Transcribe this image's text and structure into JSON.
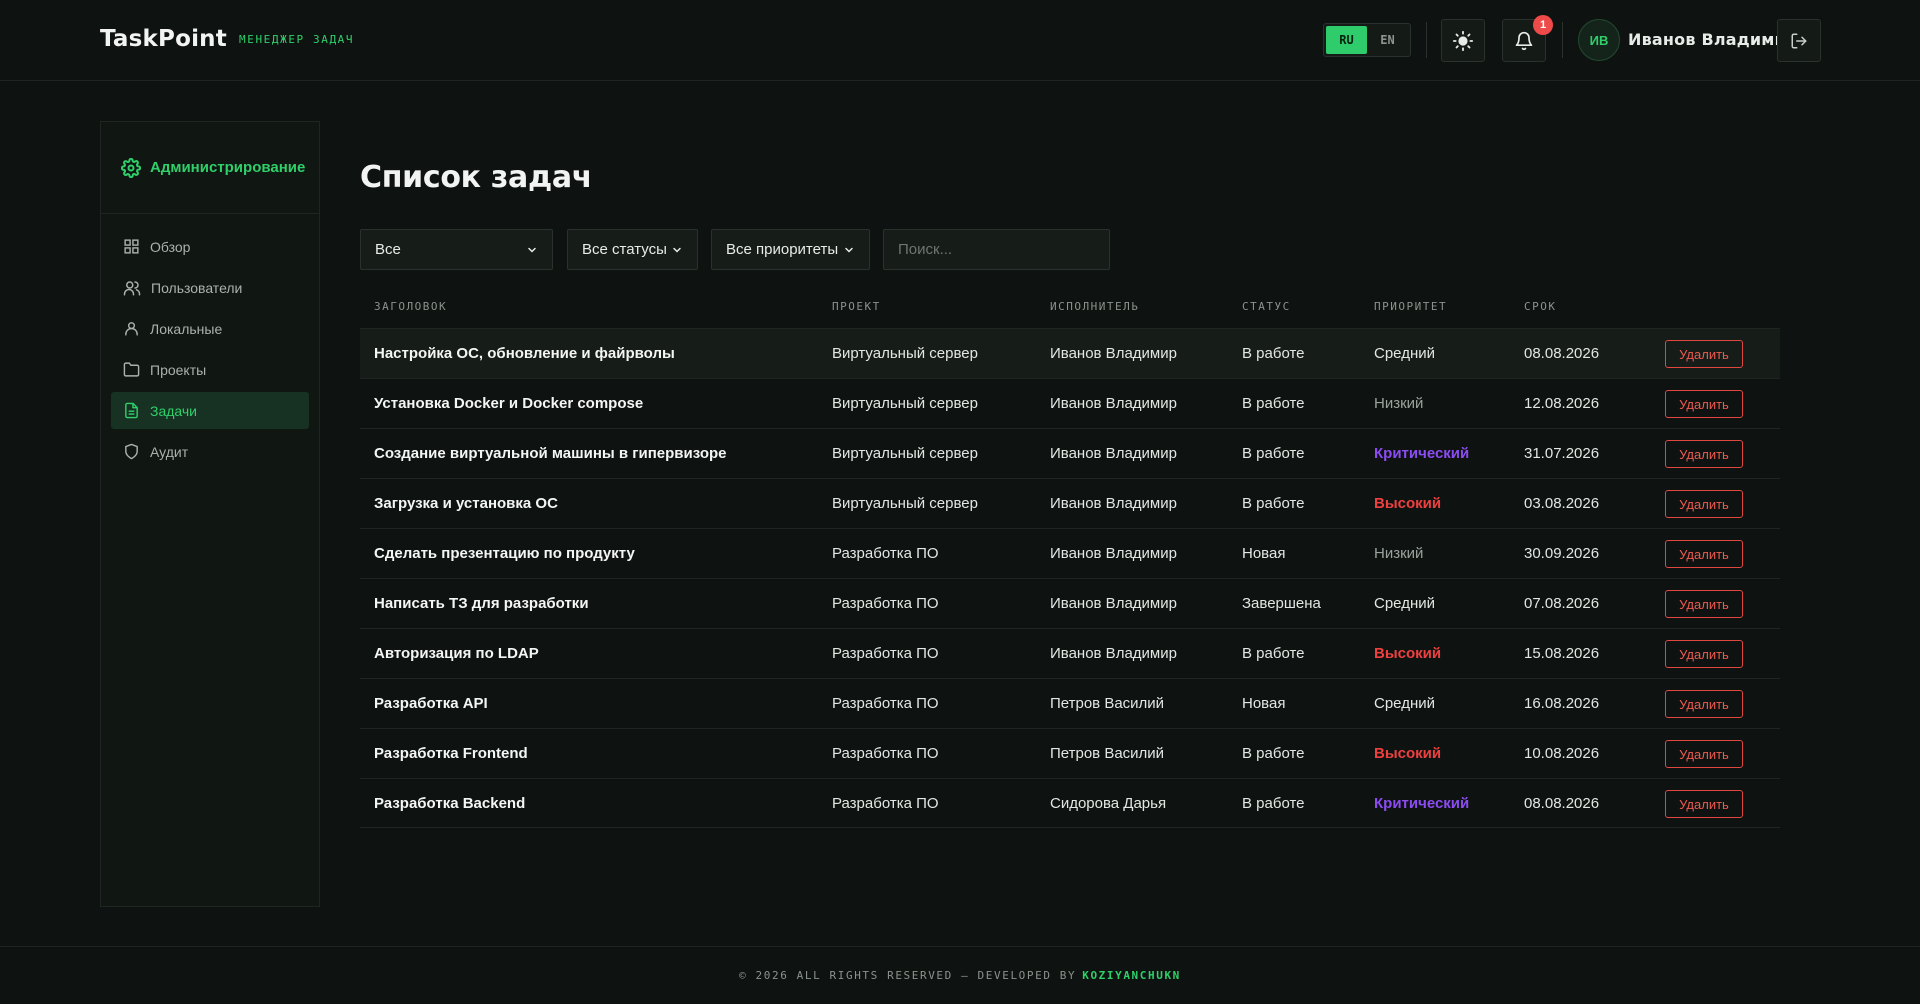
{
  "header": {
    "logo": "TaskPoint",
    "subtitle": "МЕНЕДЖЕР ЗАДАЧ",
    "lang_ru": "RU",
    "lang_en": "EN",
    "notifications_count": "1",
    "user_initials": "ИВ",
    "user_name": "Иванов Владимир"
  },
  "sidebar": {
    "section_title": "Администрирование",
    "items": [
      {
        "label": "Обзор",
        "icon": "grid-icon"
      },
      {
        "label": "Пользователи",
        "icon": "users-icon"
      },
      {
        "label": "Локальные",
        "icon": "user-icon"
      },
      {
        "label": "Проекты",
        "icon": "folder-icon"
      },
      {
        "label": "Задачи",
        "icon": "document-icon",
        "active": true
      },
      {
        "label": "Аудит",
        "icon": "shield-icon"
      }
    ]
  },
  "main": {
    "title": "Список задач",
    "filters": {
      "project": "Все",
      "status": "Все статусы",
      "priority": "Все приоритеты",
      "search_placeholder": "Поиск..."
    },
    "table": {
      "headers": [
        "ЗАГОЛОВОК",
        "ПРОЕКТ",
        "ИСПОЛНИТЕЛЬ",
        "СТАТУС",
        "ПРИОРИТЕТ",
        "СРОК"
      ],
      "delete_label": "Удалить",
      "rows": [
        {
          "title": "Настройка ОС, обновление и файрволы",
          "project": "Виртуальный сервер",
          "assignee": "Иванов Владимир",
          "status": "В работе",
          "priority": "Средний",
          "due": "08.08.2026"
        },
        {
          "title": "Установка Docker и Docker compose",
          "project": "Виртуальный сервер",
          "assignee": "Иванов Владимир",
          "status": "В работе",
          "priority": "Низкий",
          "due": "12.08.2026"
        },
        {
          "title": "Создание виртуальной машины в гипервизоре",
          "project": "Виртуальный сервер",
          "assignee": "Иванов Владимир",
          "status": "В работе",
          "priority": "Критический",
          "due": "31.07.2026"
        },
        {
          "title": "Загрузка и установка ОС",
          "project": "Виртуальный сервер",
          "assignee": "Иванов Владимир",
          "status": "В работе",
          "priority": "Высокий",
          "due": "03.08.2026"
        },
        {
          "title": "Сделать презентацию по продукту",
          "project": "Разработка ПО",
          "assignee": "Иванов Владимир",
          "status": "Новая",
          "priority": "Низкий",
          "due": "30.09.2026"
        },
        {
          "title": "Написать ТЗ для разработки",
          "project": "Разработка ПО",
          "assignee": "Иванов Владимир",
          "status": "Завершена",
          "priority": "Средний",
          "due": "07.08.2026"
        },
        {
          "title": "Авторизация по LDAP",
          "project": "Разработка ПО",
          "assignee": "Иванов Владимир",
          "status": "В работе",
          "priority": "Высокий",
          "due": "15.08.2026"
        },
        {
          "title": "Разработка API",
          "project": "Разработка ПО",
          "assignee": "Петров Василий",
          "status": "Новая",
          "priority": "Средний",
          "due": "16.08.2026"
        },
        {
          "title": "Разработка Frontend",
          "project": "Разработка ПО",
          "assignee": "Петров Василий",
          "status": "В работе",
          "priority": "Высокий",
          "due": "10.08.2026"
        },
        {
          "title": "Разработка Backend",
          "project": "Разработка ПО",
          "assignee": "Сидорова Дарья",
          "status": "В работе",
          "priority": "Критический",
          "due": "08.08.2026"
        }
      ]
    }
  },
  "priority_colors": {
    "Средний": "#e3e7e4",
    "Низкий": "#9aa39d",
    "Критический": "#8b4cf2",
    "Высокий": "#ef4040"
  },
  "colors": {
    "accent": "#2fcf6a",
    "danger": "#e0483f",
    "background": "#0e1210"
  },
  "footer": {
    "text": "© 2026 ALL RIGHTS RESERVED — DEVELOPED BY",
    "author": "KOZIYANCHUKN"
  }
}
